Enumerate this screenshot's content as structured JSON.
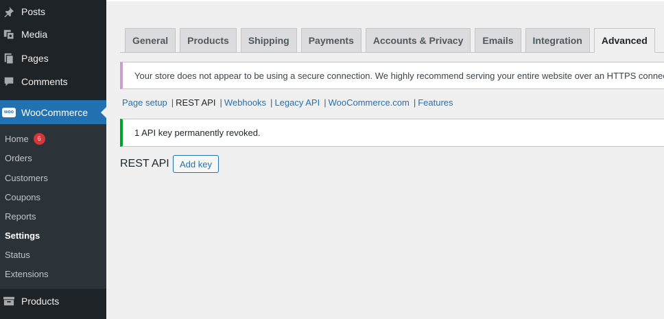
{
  "sidebar": {
    "top_items": [
      {
        "label": "Posts",
        "icon": "pin-icon"
      },
      {
        "label": "Media",
        "icon": "media-icon"
      },
      {
        "label": "Pages",
        "icon": "pages-icon"
      },
      {
        "label": "Comments",
        "icon": "comments-icon"
      }
    ],
    "woocommerce": {
      "label": "WooCommerce",
      "icon_text": "woo"
    },
    "submenu": [
      {
        "label": "Home",
        "badge": "6"
      },
      {
        "label": "Orders"
      },
      {
        "label": "Customers"
      },
      {
        "label": "Coupons"
      },
      {
        "label": "Reports"
      },
      {
        "label": "Settings"
      },
      {
        "label": "Status"
      },
      {
        "label": "Extensions"
      }
    ],
    "products": {
      "label": "Products"
    }
  },
  "tabs": [
    "General",
    "Products",
    "Shipping",
    "Payments",
    "Accounts & Privacy",
    "Emails",
    "Integration",
    "Advanced"
  ],
  "active_tab": "Advanced",
  "notices": {
    "https_warning": "Your store does not appear to be using a secure connection. We highly recommend serving your entire website over an HTTPS connection to help keep customer data secure.",
    "success": "1 API key permanently revoked."
  },
  "subnav": [
    "Page setup",
    "REST API",
    "Webhooks",
    "Legacy API",
    "WooCommerce.com",
    "Features"
  ],
  "current_subnav": "REST API",
  "section": {
    "title": "REST API",
    "add_button": "Add key"
  },
  "colors": {
    "accent": "#2271b1",
    "sidebar": "#1d2327",
    "badge": "#d63638",
    "success": "#00a32a"
  }
}
